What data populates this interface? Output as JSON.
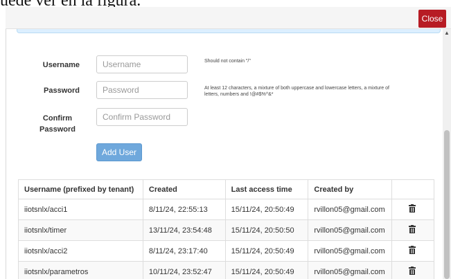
{
  "background_text": "uede ver en la figura.",
  "header": {
    "close_label": "Close"
  },
  "form": {
    "username": {
      "label": "Username",
      "placeholder": "Username",
      "hint": "Should not contain \"/\""
    },
    "password": {
      "label": "Password",
      "placeholder": "Password",
      "hint": "At least 12 characters, a mixture of both uppercase and lowercase letters, a mixture of letters, numbers and !@#$%^&*"
    },
    "confirm": {
      "label": "Confirm Password",
      "placeholder": "Confirm Password"
    },
    "add_label": "Add User"
  },
  "table": {
    "headers": [
      "Username (prefixed by tenant)",
      "Created",
      "Last access time",
      "Created by",
      ""
    ],
    "rows": [
      {
        "username": "iiotsnlx/acci1",
        "created": "8/11/24, 22:55:13",
        "last_access": "15/11/24, 20:50:49",
        "created_by": "rvillon05@gmail.com",
        "action_icon": "trash-icon"
      },
      {
        "username": "iiotsnlx/timer",
        "created": "13/11/24, 23:54:48",
        "last_access": "15/11/24, 20:50:50",
        "created_by": "rvillon05@gmail.com",
        "action_icon": "trash-icon"
      },
      {
        "username": "iiotsnlx/acci2",
        "created": "8/11/24, 23:17:40",
        "last_access": "15/11/24, 20:50:49",
        "created_by": "rvillon05@gmail.com",
        "action_icon": "trash-icon"
      },
      {
        "username": "iiotsnlx/parametros",
        "created": "10/11/24, 23:52:47",
        "last_access": "15/11/24, 20:50:49",
        "created_by": "rvillon05@gmail.com",
        "action_icon": "trash-icon"
      }
    ]
  },
  "colors": {
    "close_button": "#b71c24",
    "add_button": "#6fa8dc",
    "info_bar": "#dcefff"
  }
}
